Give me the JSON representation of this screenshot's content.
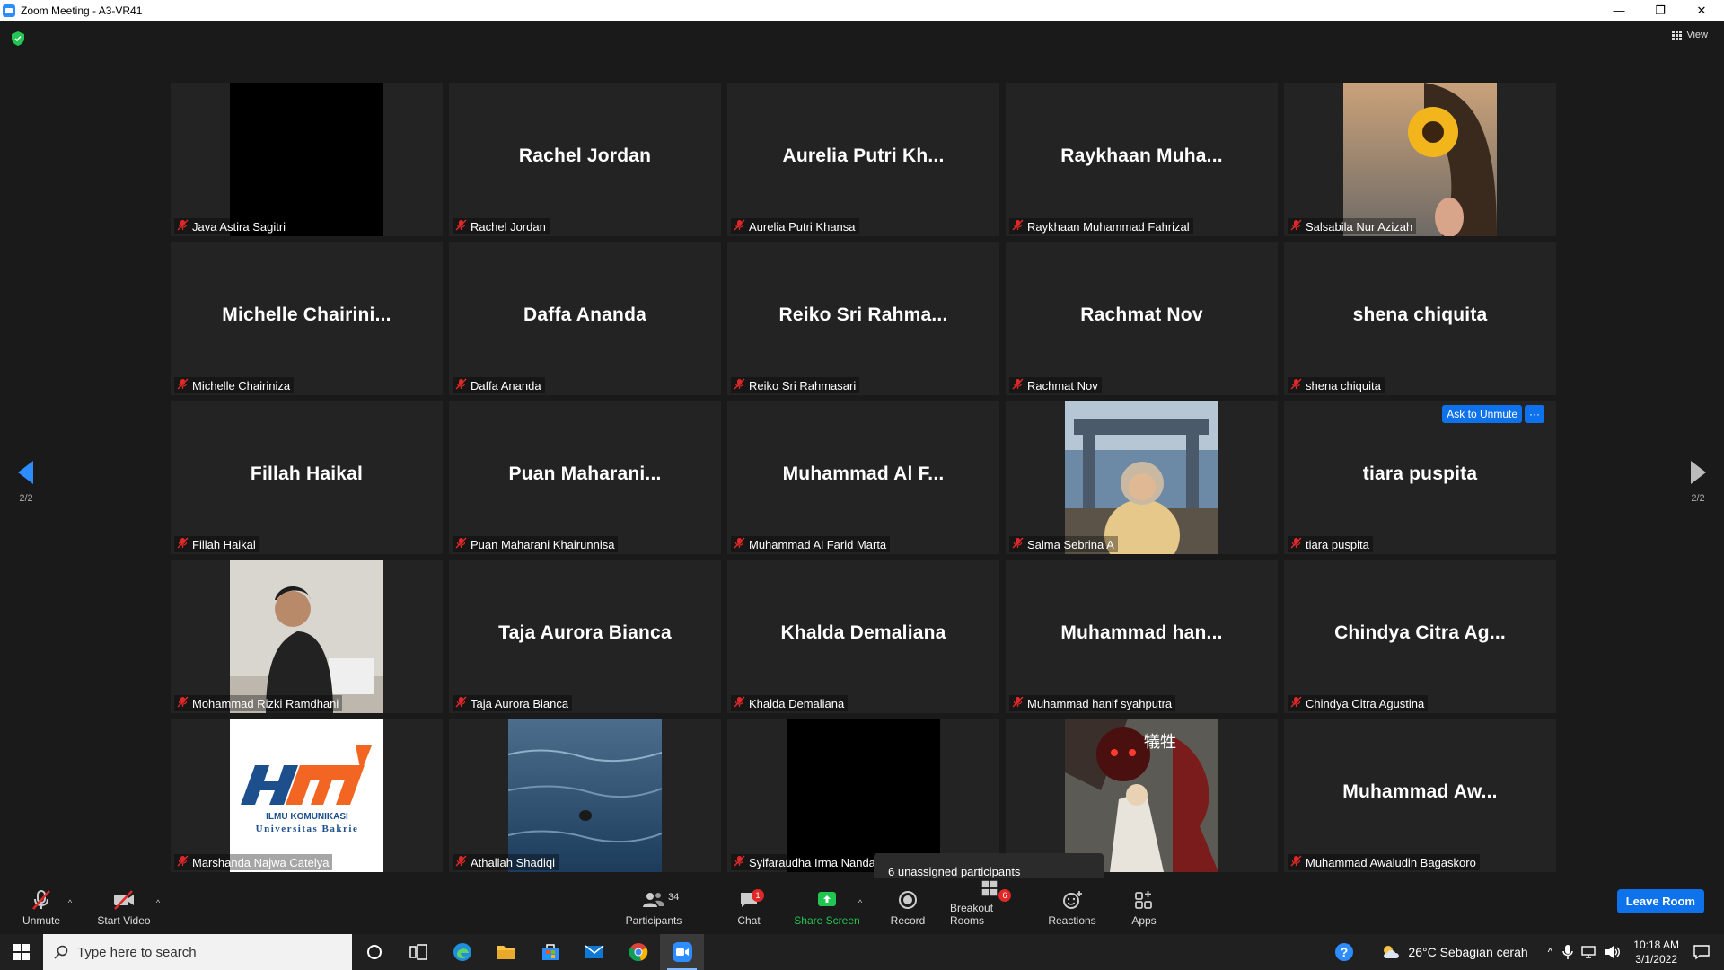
{
  "window": {
    "title": "Zoom Meeting - A3-VR41",
    "minimize": "—",
    "restore": "❐",
    "close": "✕"
  },
  "view_button": {
    "label": "View"
  },
  "pager": {
    "left": "2/2",
    "right": "2/2"
  },
  "tiles": [
    {
      "big": "",
      "label": "Java Astira Sagitri",
      "video": "black"
    },
    {
      "big": "Rachel Jordan",
      "label": "Rachel Jordan"
    },
    {
      "big": "Aurelia  Putri  Kh...",
      "label": "Aurelia Putri Khansa"
    },
    {
      "big": "Raykhaan  Muha...",
      "label": "Raykhaan Muhammad Fahrizal"
    },
    {
      "big": "",
      "label": "Salsabila Nur Azizah",
      "video": "sunflower"
    },
    {
      "big": "Michelle  Chairini...",
      "label": "Michelle Chairiniza"
    },
    {
      "big": "Daffa Ananda",
      "label": "Daffa Ananda"
    },
    {
      "big": "Reiko  Sri  Rahma...",
      "label": "Reiko Sri Rahmasari"
    },
    {
      "big": "Rachmat Nov",
      "label": "Rachmat Nov"
    },
    {
      "big": "shena chiquita",
      "label": "shena chiquita"
    },
    {
      "big": "Fillah Haikal",
      "label": "Fillah Haikal"
    },
    {
      "big": "Puan  Maharani...",
      "label": "Puan Maharani Khairunnisa"
    },
    {
      "big": "Muhammad  Al  F...",
      "label": "Muhammad Al Farid Marta"
    },
    {
      "big": "",
      "label": "Salma Sebrina A",
      "video": "person-outdoor"
    },
    {
      "big": "tiara puspita",
      "label": "tiara puspita",
      "ask_to_unmute": "Ask to Unmute",
      "more": "···"
    },
    {
      "big": "",
      "label": "Mohammad Rizki Ramdhani",
      "video": "person-room"
    },
    {
      "big": "Taja Aurora Bianca",
      "label": "Taja Aurora Bianca"
    },
    {
      "big": "Khalda Demaliana",
      "label": "Khalda Demaliana"
    },
    {
      "big": "Muhammad  han...",
      "label": "Muhammad hanif syahputra"
    },
    {
      "big": "Chindya  Citra  Ag...",
      "label": "Chindya Citra Agustina"
    },
    {
      "big": "",
      "label": "Marshanda Najwa Catelya",
      "video": "logo"
    },
    {
      "big": "",
      "label": "Athallah Shadiqi",
      "video": "sea"
    },
    {
      "big": "",
      "label": "Syifaraudha Irma Nanda",
      "video": "black"
    },
    {
      "big": "",
      "label": "",
      "video": "anime"
    },
    {
      "big": "Muhammad  Aw...",
      "label": "Muhammad Awaludin Bagaskoro"
    }
  ],
  "logo_text": {
    "line1": "ILMU KOMUNIKASI",
    "line2": "Universitas Bakrie"
  },
  "anime_text": "犠牲",
  "toast": "6 unassigned participants",
  "toolbar": {
    "unmute": "Unmute",
    "start_video": "Start Video",
    "participants": "Participants",
    "participants_count": "34",
    "chat": "Chat",
    "chat_badge": "1",
    "share_screen": "Share Screen",
    "record": "Record",
    "breakout": "Breakout Rooms",
    "breakout_badge": "6",
    "reactions": "Reactions",
    "apps": "Apps",
    "leave": "Leave Room"
  },
  "taskbar": {
    "search_placeholder": "Type here to search",
    "weather": "26°C  Sebagian cerah",
    "time": "10:18 AM",
    "date": "3/1/2022"
  },
  "colors": {
    "accent": "#0e72ed",
    "share_green": "#23c552",
    "muted_red": "#e02828",
    "tile_bg": "#232323"
  }
}
